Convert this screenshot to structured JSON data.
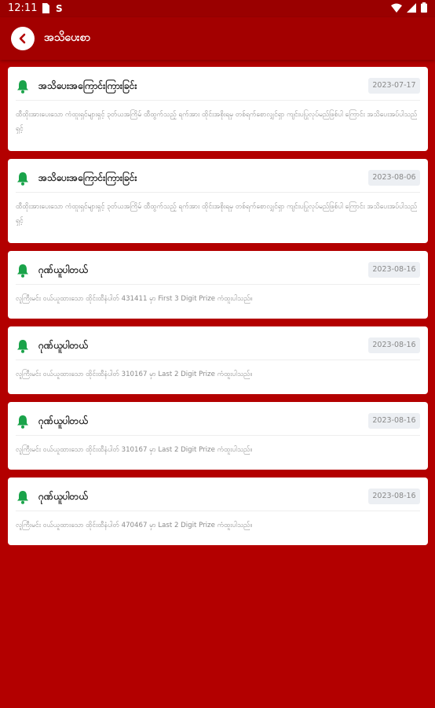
{
  "status_bar": {
    "time": "12:11"
  },
  "app_bar": {
    "title": "အသိပေးစာ"
  },
  "notifications": [
    {
      "title": "အသိပေးအကြောင်းကြားခြင်း",
      "date": "2023-07-17",
      "body": "ထီထိုးအားပေးသော ကံထူးရှင်များရှင့် ၃တ်ယအကြိမ် ထီထွက်သည့် ရက်အား ထိုင်းအစိုးရမှ တစ်ရက်စောလျှင်ရှာ ကျင်းပပြုလုပ်မည်ဖြစ်ပါ ကြောင်း အသိပေးအပ်ပါသည်ရှင့်"
    },
    {
      "title": "အသိပေးအကြောင်းကြားခြင်း",
      "date": "2023-08-06",
      "body": "ထီထိုးအားပေးသော ကံထူးရှင်များရှင့် ၃တ်ယအကြိမ် ထီထွက်သည့် ရက်အား ထိုင်းအစိုးရမှ တစ်ရက်စောလျှင်ရှာ ကျင်းပပြုလုပ်မည်ဖြစ်ပါ ကြောင်း အသိပေးအပ်ပါသည်ရှင့်"
    },
    {
      "title": "ဂုဏ်ယူပါတယ်",
      "date": "2023-08-16",
      "body": "လူကြီးမင်း ဝယ်ယူထားသော ထိုင်းထီနံပါတ် 431411 မှာ First 3 Digit Prize ကံထူးပါသည်။"
    },
    {
      "title": "ဂုဏ်ယူပါတယ်",
      "date": "2023-08-16",
      "body": "လူကြီးမင်း ဝယ်ယူထားသော ထိုင်းထီနံပါတ် 310167 မှာ Last 2 Digit Prize ကံထူးပါသည်။"
    },
    {
      "title": "ဂုဏ်ယူပါတယ်",
      "date": "2023-08-16",
      "body": "လူကြီးမင်း ဝယ်ယူထားသော ထိုင်းထီနံပါတ် 310167 မှာ Last 2 Digit Prize ကံထူးပါသည်။"
    },
    {
      "title": "ဂုဏ်ယူပါတယ်",
      "date": "2023-08-16",
      "body": "လူကြီးမင်း ဝယ်ယူထားသော ထိုင်းထီနံပါတ် 470467 မှာ Last 2 Digit Prize ကံထူးပါသည်။"
    }
  ],
  "colors": {
    "background": "#b30000",
    "app_bar": "#a30000",
    "bell": "#1aa34a"
  }
}
